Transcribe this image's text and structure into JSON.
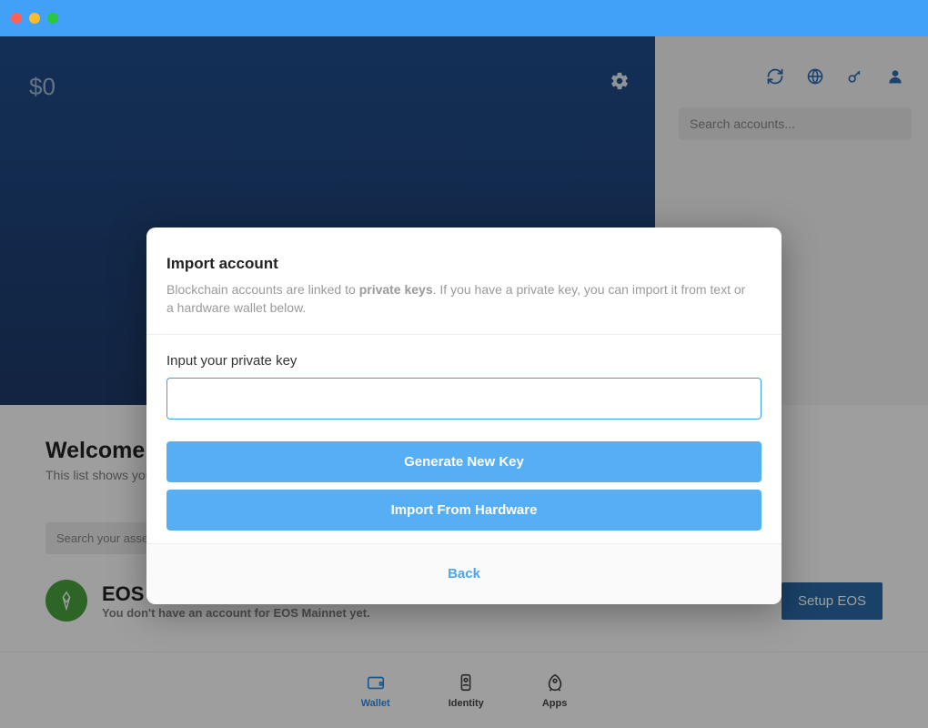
{
  "hero": {
    "balance": "$0"
  },
  "sidebar": {
    "search_placeholder": "Search accounts..."
  },
  "welcome": {
    "title": "Welcome to your new wallet",
    "subtitle": "This list shows you"
  },
  "assets": {
    "search_placeholder": "Search your assets",
    "eos": {
      "name": "EOS",
      "subtitle": "You don't have an account for EOS Mainnet yet.",
      "setup_label": "Setup EOS"
    }
  },
  "nav": {
    "wallet": "Wallet",
    "identity": "Identity",
    "apps": "Apps"
  },
  "modal": {
    "title": "Import account",
    "desc_pre": "Blockchain accounts are linked to ",
    "desc_bold": "private keys",
    "desc_post": ". If you have a private key, you can import it from text or a hardware wallet below.",
    "input_label": "Input your private key",
    "generate_label": "Generate New Key",
    "hardware_label": "Import From Hardware",
    "back_label": "Back"
  }
}
